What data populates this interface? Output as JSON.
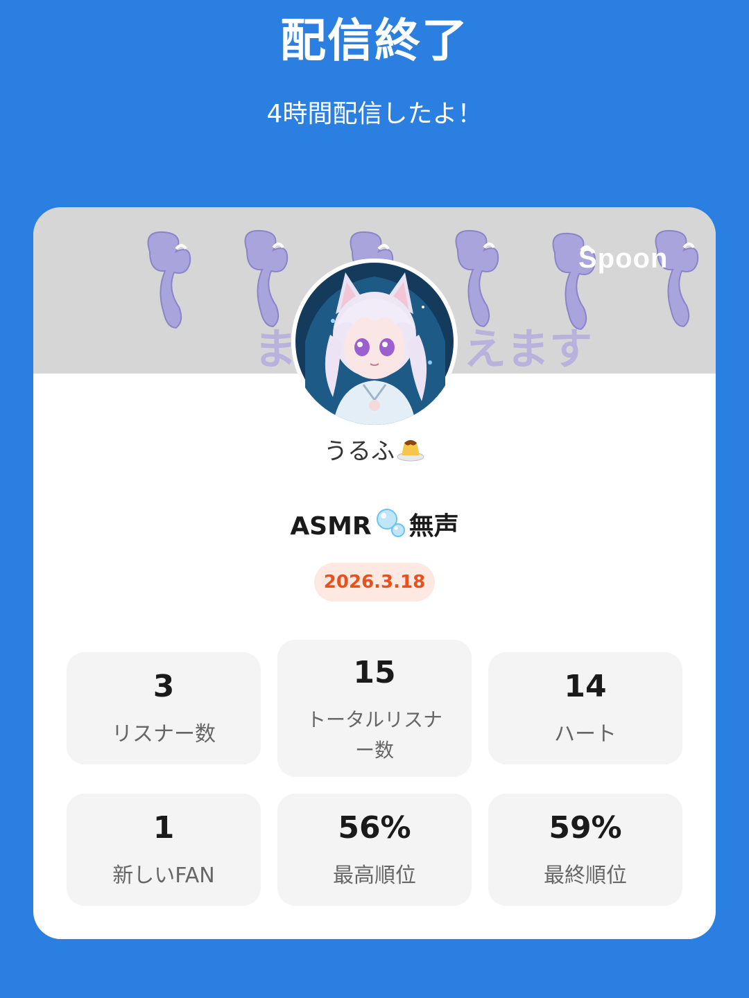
{
  "header": {
    "title": "配信終了",
    "subtitle": "4時間配信したよ！"
  },
  "banner": {
    "brand": "Spoon",
    "background_text": "ままえます",
    "background_color": "#d6d6d6"
  },
  "profile": {
    "username": "うるふ",
    "username_emoji": "pudding-icon"
  },
  "stream": {
    "title_prefix": "ASMR",
    "title_emoji": "bubbles-icon",
    "title_suffix": "無声",
    "date": "2026.3.18"
  },
  "stats": [
    {
      "value": "3",
      "label": "リスナー数"
    },
    {
      "value": "15",
      "label": "トータルリスナー数"
    },
    {
      "value": "14",
      "label": "ハート"
    },
    {
      "value": "1",
      "label": "新しいFAN"
    },
    {
      "value": "56%",
      "label": "最高順位"
    },
    {
      "value": "59%",
      "label": "最終順位"
    }
  ],
  "colors": {
    "background": "#2a7fe0",
    "card": "#ffffff",
    "stat_box": "#f4f4f4",
    "date_text": "#e8501c",
    "date_badge": "#fde9e2"
  }
}
